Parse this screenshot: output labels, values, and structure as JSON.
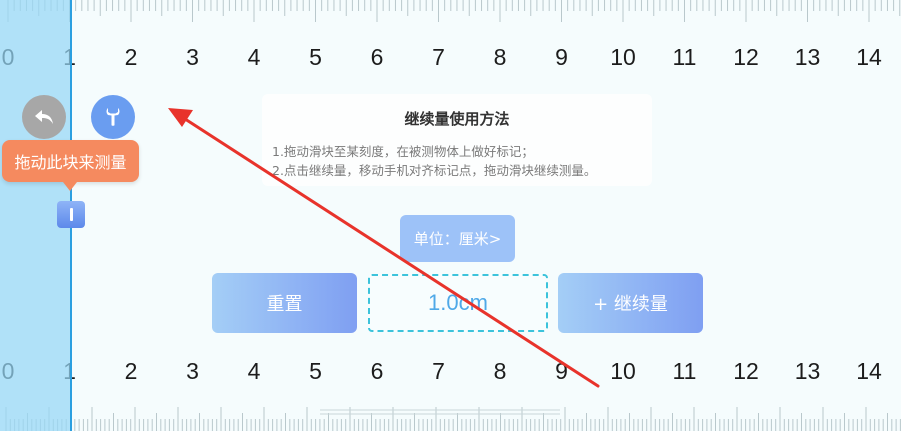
{
  "ruler": {
    "top_numbers": [
      "0",
      "1",
      "2",
      "3",
      "4",
      "5",
      "6",
      "7",
      "8",
      "9",
      "10",
      "11",
      "12",
      "13",
      "14"
    ],
    "bottom_numbers": [
      "0",
      "1",
      "2",
      "3",
      "4",
      "5",
      "6",
      "7",
      "8",
      "9",
      "10",
      "11",
      "12",
      "13",
      "14"
    ]
  },
  "controls": {
    "back_icon": "undo-arrow-icon",
    "settings_icon": "wrench-icon",
    "tooltip_label": "拖动此块来测量"
  },
  "instructions": {
    "title": "继续量使用方法",
    "line1": "1.拖动滑块至某刻度，在被测物体上做好标记；",
    "line2": "2.点击继续量，移动手机对齐标记点，拖动滑块继续测量。"
  },
  "unit_button_label": "单位：厘米>",
  "reset_label": "重置",
  "measurement_value": "1.0cm",
  "continue_label": "+ 继续量",
  "colors": {
    "accent_blue": "#6a9df0",
    "tooltip_orange": "#f58a5f",
    "dashed_cyan": "#3cc3db",
    "annotation_red": "#e8332b"
  }
}
